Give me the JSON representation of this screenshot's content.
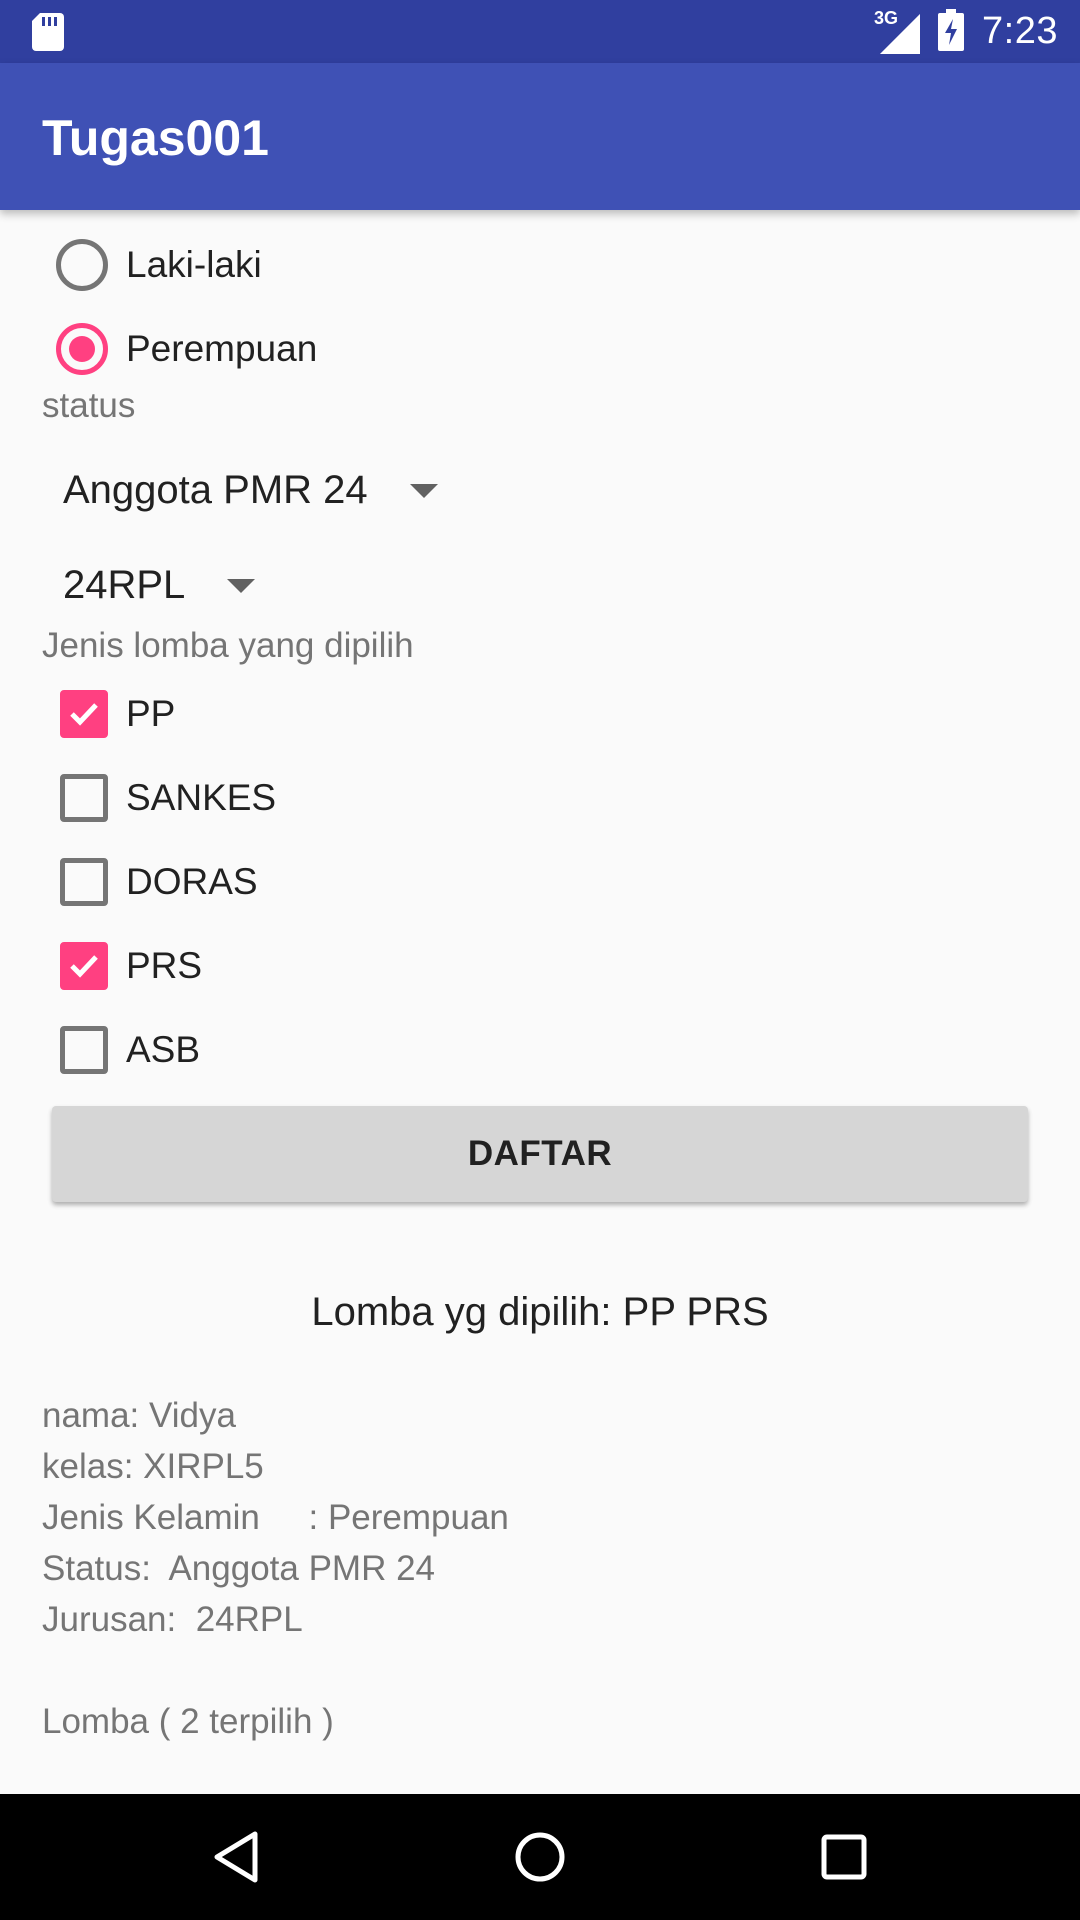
{
  "status_bar": {
    "network": "3G",
    "time": "7:23"
  },
  "app_bar": {
    "title": "Tugas001"
  },
  "gender": {
    "options": [
      {
        "label": "Laki-laki",
        "selected": false
      },
      {
        "label": "Perempuan",
        "selected": true
      }
    ]
  },
  "status": {
    "label": "status",
    "selected": "Anggota PMR 24"
  },
  "jurusan": {
    "selected": "24RPL"
  },
  "lomba": {
    "label": "Jenis lomba yang dipilih",
    "options": [
      {
        "label": "PP",
        "checked": true
      },
      {
        "label": "SANKES",
        "checked": false
      },
      {
        "label": "DORAS",
        "checked": false
      },
      {
        "label": "PRS",
        "checked": true
      },
      {
        "label": "ASB",
        "checked": false
      }
    ]
  },
  "button": {
    "label": "DAFTAR"
  },
  "result": {
    "lomba_dipilih": "Lomba yg dipilih: PP PRS",
    "nama": "nama: Vidya",
    "kelas": "kelas: XIRPL5",
    "jenis_kelamin": "Jenis Kelamin     : Perempuan",
    "status": "Status:  Anggota PMR 24",
    "jurusan": "Jurusan:  24RPL",
    "lomba_count": "Lomba ( 2 terpilih )"
  },
  "colors": {
    "primary": "#3f51b5",
    "primary_dark": "#303f9f",
    "accent": "#ff4081"
  }
}
